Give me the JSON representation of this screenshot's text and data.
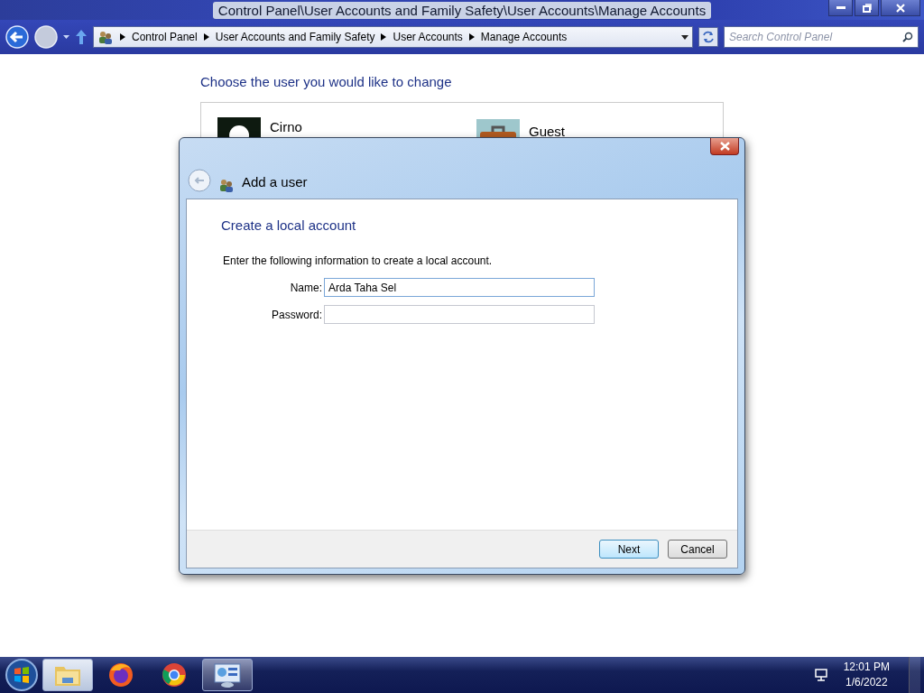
{
  "window": {
    "title": "Control Panel\\User Accounts and Family Safety\\User Accounts\\Manage Accounts"
  },
  "navigation": {
    "breadcrumbs": [
      "Control Panel",
      "User Accounts and Family Safety",
      "User Accounts",
      "Manage Accounts"
    ],
    "search": {
      "placeholder": "Search Control Panel"
    }
  },
  "content": {
    "heading": "Choose the user you would like to change",
    "accounts": [
      {
        "name": "Cirno",
        "kind": "silhouette"
      },
      {
        "name": "Guest",
        "kind": "suitcase"
      }
    ]
  },
  "dialog": {
    "title": "Add a user",
    "heading": "Create a local account",
    "instructions": "Enter the following information to create a local account.",
    "fields": [
      {
        "label": "Name:",
        "value": "Arda Taha Sel",
        "focused": true
      },
      {
        "label": "Password:",
        "focused": false
      }
    ],
    "buttons": [
      {
        "label": "Next",
        "default": true
      },
      {
        "label": "Cancel",
        "default": false
      }
    ]
  },
  "taskbar": {
    "apps": [
      {
        "kind": "explorer",
        "running": true
      },
      {
        "kind": "firefox",
        "running": false
      },
      {
        "kind": "chrome",
        "running": false
      },
      {
        "kind": "control-panel",
        "running": true
      }
    ],
    "time": "12:01 PM",
    "date": "1/6/2022"
  }
}
